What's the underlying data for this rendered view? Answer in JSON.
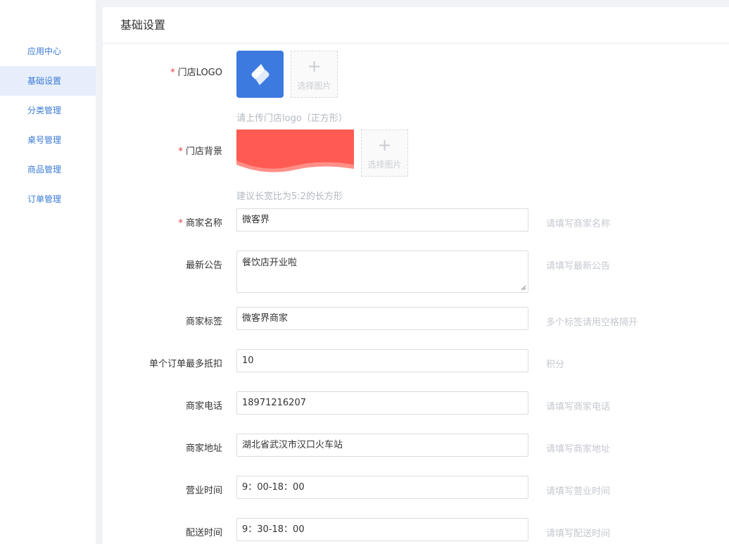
{
  "sidebar": {
    "items": [
      {
        "label": "应用中心",
        "active": false
      },
      {
        "label": "基础设置",
        "active": true
      },
      {
        "label": "分类管理",
        "active": false
      },
      {
        "label": "桌号管理",
        "active": false
      },
      {
        "label": "商品管理",
        "active": false
      },
      {
        "label": "订单管理",
        "active": false
      }
    ]
  },
  "panel": {
    "title": "基础设置"
  },
  "form": {
    "logo": {
      "required_mark": "*",
      "label": "门店LOGO",
      "upload_plus": "+",
      "upload_text": "选择图片",
      "hint": "请上传门店logo（正方形）"
    },
    "background": {
      "required_mark": "*",
      "label": "门店背景",
      "upload_plus": "+",
      "upload_text": "选择图片",
      "hint": "建议长宽比为5:2的长方形"
    },
    "merchant_name": {
      "required_mark": "*",
      "label": "商家名称",
      "value": "微客界",
      "hint": "请填写商家名称"
    },
    "notice": {
      "label": "最新公告",
      "value": "餐饮店开业啦",
      "hint": "请填写最新公告"
    },
    "tags": {
      "label": "商家标签",
      "value": "微客界商家",
      "hint": "多个标签请用空格隔开"
    },
    "max_deduct": {
      "label": "单个订单最多抵扣",
      "value": "10",
      "hint": "积分"
    },
    "phone": {
      "label": "商家电话",
      "value": "18971216207",
      "hint": "请填写商家电话"
    },
    "address": {
      "label": "商家地址",
      "value": "湖北省武汉市汉口火车站",
      "hint": "请填写商家地址"
    },
    "business_hours": {
      "label": "营业时间",
      "value": "9：00-18：00",
      "hint": "请填写营业时间"
    },
    "delivery_hours": {
      "label": "配送时间",
      "value": "9：30-18：00",
      "hint": "请填写配送时间"
    }
  },
  "colors": {
    "accent": "#3a7bd5",
    "required": "#e4393c",
    "logo_bg": "#3d7ae0",
    "banner_bg": "#ff5b52"
  }
}
